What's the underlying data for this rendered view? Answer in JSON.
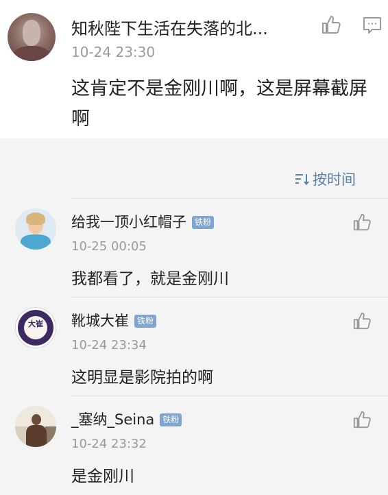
{
  "main_comment": {
    "username": "知秋陛下生活在失落的北...",
    "time": "10-24 23:30",
    "text": "这肯定不是金刚川啊，这是屏幕截屏啊",
    "like_icon": "thumbs-up-icon",
    "comment_icon": "comment-icon"
  },
  "sort": {
    "label": "按时间",
    "icon": "sort-icon"
  },
  "replies": [
    {
      "username": "给我一顶小红帽子",
      "badge": "铁粉",
      "time": "10-25 00:05",
      "text": "我都看了，就是金刚川"
    },
    {
      "username": "靴城大崔",
      "badge": "铁粉",
      "time": "10-24 23:34",
      "text": "这明显是影院拍的啊",
      "avatar_seal": "大崔"
    },
    {
      "username": "_塞纳_Seina",
      "badge": "铁粉",
      "time": "10-24 23:32",
      "text": "是金刚川"
    }
  ],
  "colors": {
    "link_blue": "#5a7fa8",
    "badge_blue": "#7ea4cf",
    "timestamp_gray": "#9a9a9a",
    "background": "#f4f4f4"
  }
}
